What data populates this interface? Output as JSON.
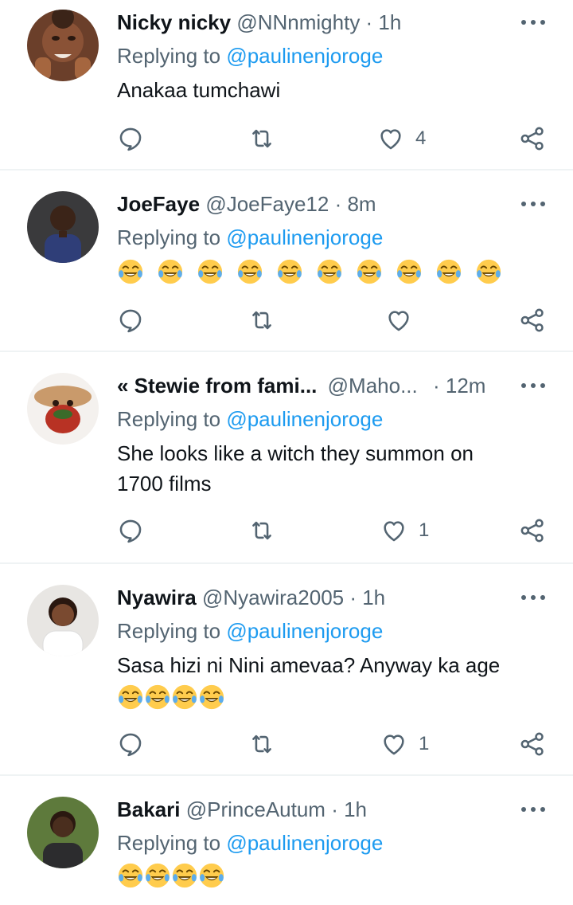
{
  "tweets": [
    {
      "name": "Nicky nicky",
      "handle": "@NNnmighty",
      "time": "· 1h",
      "replying_prefix": "Replying to ",
      "replying_handle": "@paulinenjoroge",
      "text": "Anakaa tumchawi",
      "emoji_count": 0,
      "like_count": "4"
    },
    {
      "name": "JoeFaye",
      "handle": "@JoeFaye12",
      "time": "· 8m",
      "replying_prefix": "Replying to ",
      "replying_handle": "@paulinenjoroge",
      "text": "",
      "emoji_count": 10,
      "like_count": ""
    },
    {
      "name": "« Stewie from fami...",
      "handle": "@Maho...",
      "time": "· 12m",
      "replying_prefix": "Replying to ",
      "replying_handle": "@paulinenjoroge",
      "text": "She looks like a witch they summon on 1700 films",
      "emoji_count": 0,
      "like_count": "1"
    },
    {
      "name": "Nyawira",
      "handle": "@Nyawira2005",
      "time": "· 1h",
      "replying_prefix": "Replying to ",
      "replying_handle": "@paulinenjoroge",
      "text": "Sasa hizi ni Nini amevaa? Anyway ka age",
      "emoji_count": 4,
      "like_count": "1"
    },
    {
      "name": "Bakari",
      "handle": "@PrinceAutum",
      "time": "· 1h",
      "replying_prefix": "Replying to ",
      "replying_handle": "@paulinenjoroge",
      "text": "",
      "emoji_count": 4,
      "like_count": ""
    }
  ],
  "icons": {
    "reply": "reply-icon",
    "retweet": "retweet-icon",
    "like": "heart-icon",
    "share": "share-icon",
    "more": "more-icon",
    "emoji": "face-with-tears-of-joy-icon"
  },
  "colors": {
    "link": "#1d9bf0",
    "muted": "#536471",
    "text": "#0f1419",
    "divider": "#eff3f4"
  }
}
